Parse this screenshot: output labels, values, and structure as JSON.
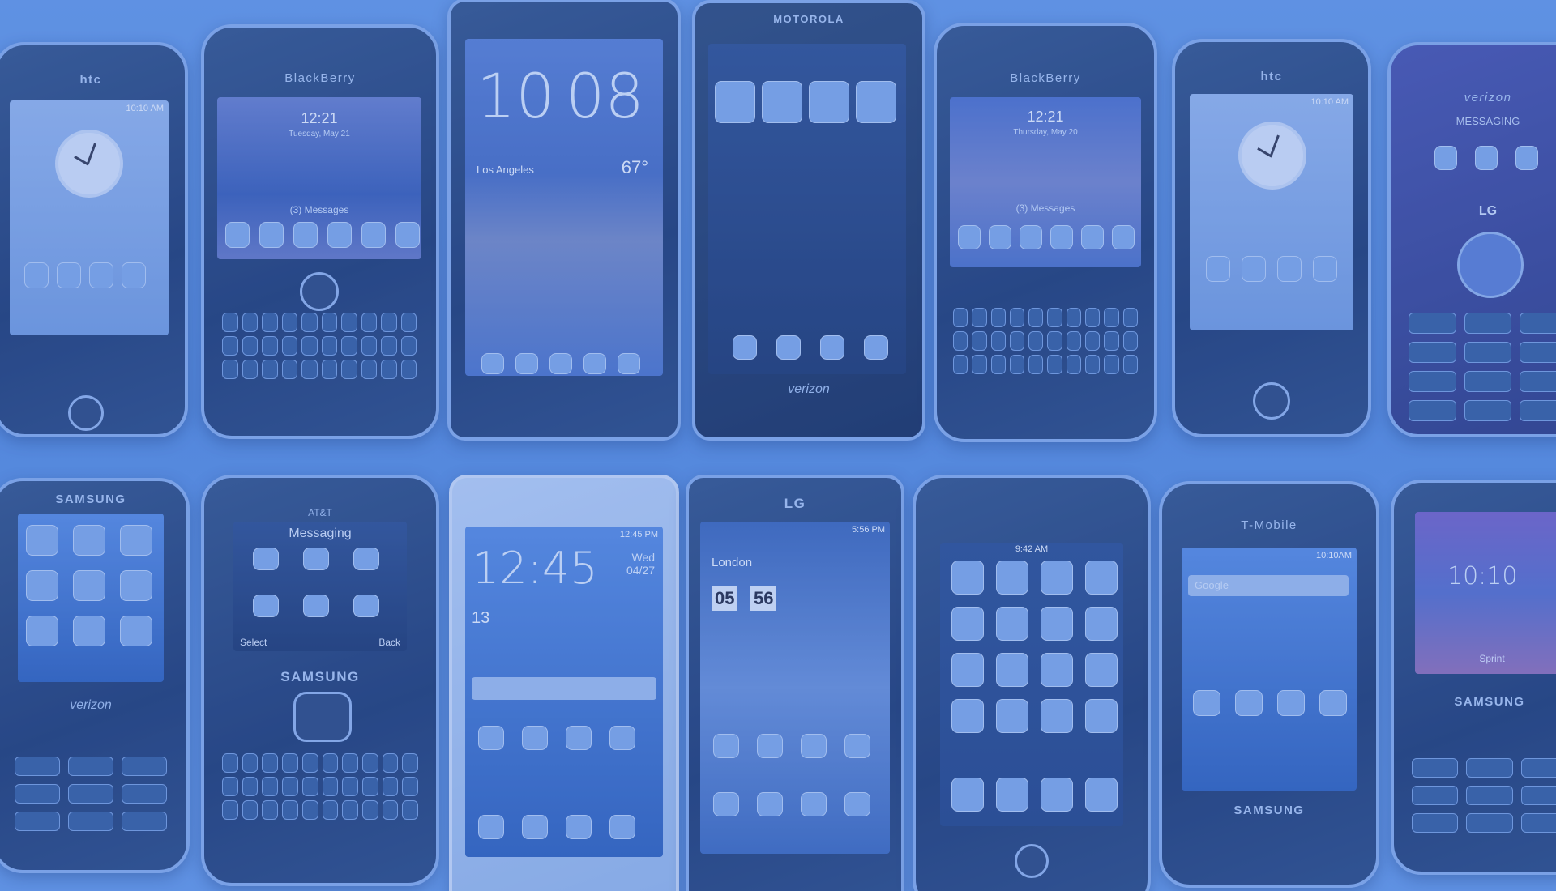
{
  "scene": {
    "tint_color": "#5b8fdc",
    "top_row": [
      {
        "brand": "htc",
        "time": "10:10 AM"
      },
      {
        "brand": "BlackBerry",
        "time": "12:21",
        "date": "Tuesday, May 21",
        "notice": "(3) Messages"
      },
      {
        "brand": "",
        "hour": "10",
        "minute": "08",
        "location": "Los Angeles",
        "temp": "67°"
      },
      {
        "brand": "MOTOROLA",
        "carrier": "verizon"
      },
      {
        "brand": "BlackBerry",
        "time": "12:21",
        "date": "Thursday, May 20",
        "notice": "(3) Messages"
      },
      {
        "brand": "htc",
        "time": "10:10 AM"
      },
      {
        "brand": "verizon",
        "title": "MESSAGING",
        "maker": "LG"
      }
    ],
    "bottom_row": [
      {
        "brand": "SAMSUNG",
        "carrier": "verizon"
      },
      {
        "brand": "SAMSUNG",
        "carrier": "AT&T",
        "title": "Messaging",
        "left": "Select",
        "right": "Back"
      },
      {
        "brand": "",
        "time": "12:45",
        "date": "Wed 04/27",
        "day": "13"
      },
      {
        "brand": "LG",
        "city": "London",
        "hh": "05",
        "mm": "56",
        "status": "5:56 PM"
      },
      {
        "brand": "",
        "status": "9:42 AM"
      },
      {
        "brand": "T-Mobile",
        "maker": "SAMSUNG",
        "status": "10:10AM",
        "search": "Google"
      },
      {
        "brand": "SAMSUNG",
        "time": "10:10",
        "carrier": "Sprint"
      }
    ]
  }
}
